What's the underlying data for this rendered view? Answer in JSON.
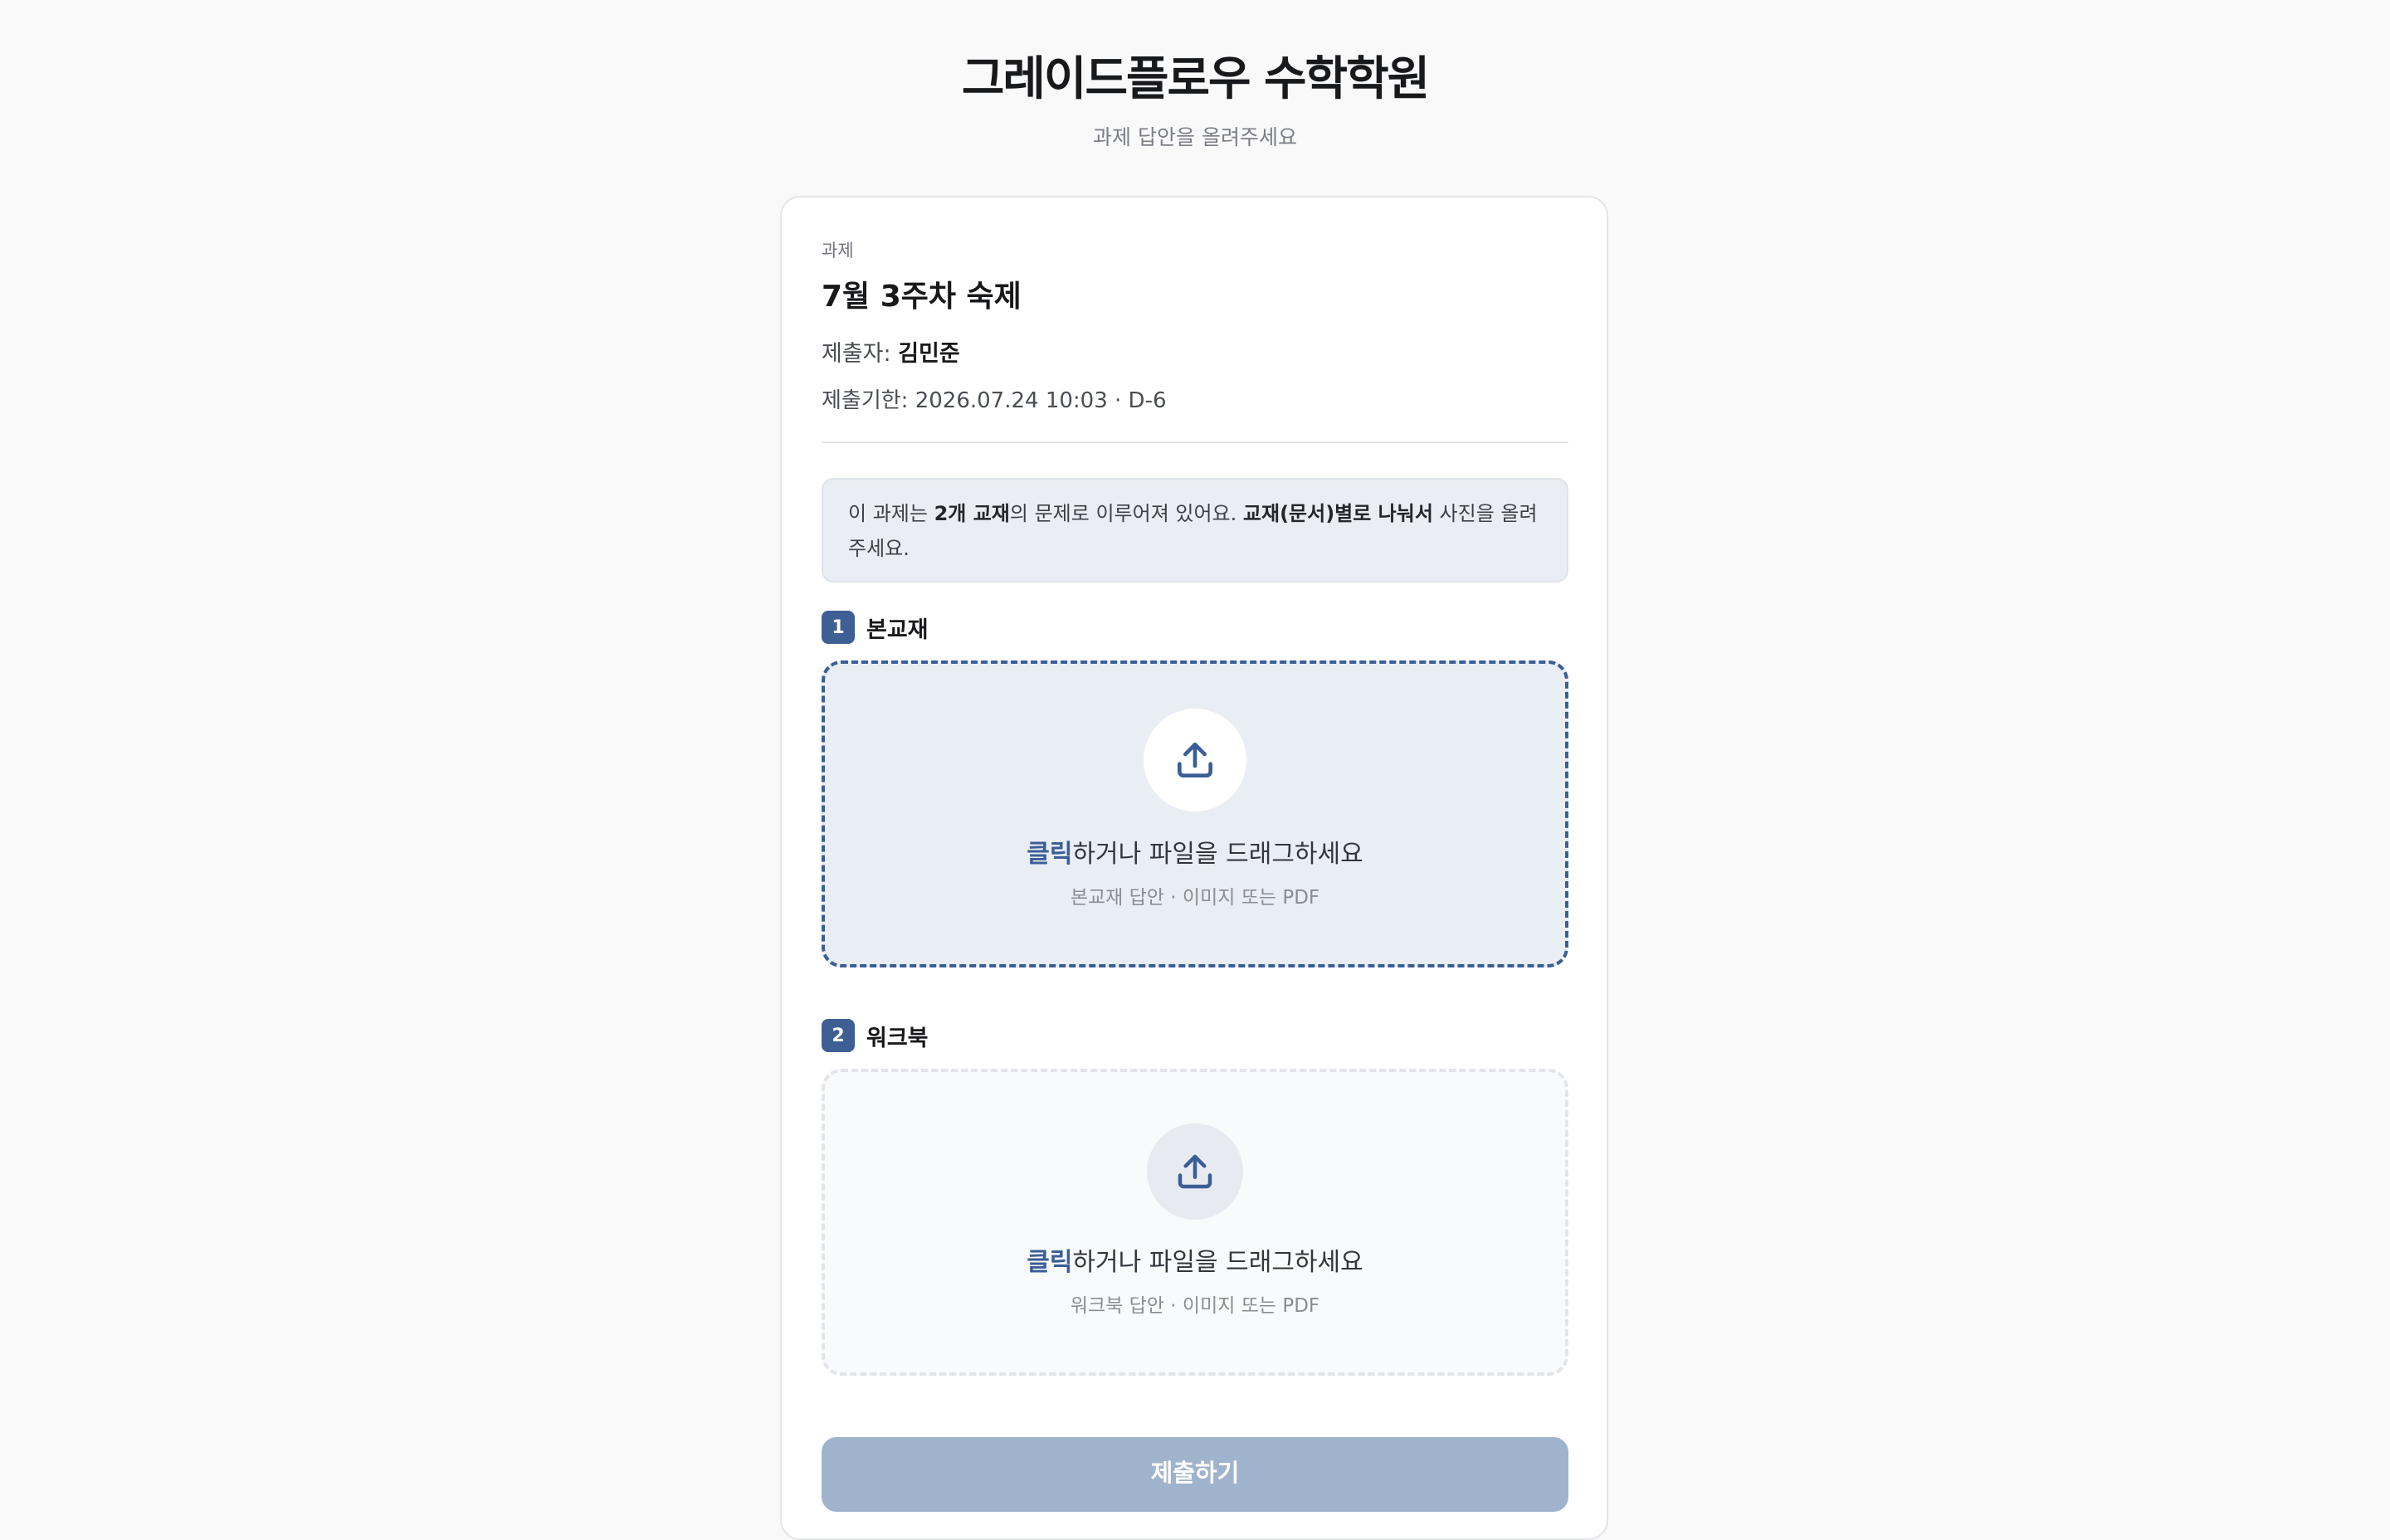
{
  "header": {
    "title": "그레이드플로우 수학학원",
    "subtitle": "과제 답안을 올려주세요"
  },
  "assignment": {
    "label": "과제",
    "title": "7월 3주차 숙제",
    "submitter_label": "제출자: ",
    "submitter_name": "김민준",
    "deadline": "제출기한: 2026.07.24 10:03 · D-6"
  },
  "notice": {
    "part1": "이 과제는 ",
    "bold1": "2개 교재",
    "part2": "의 문제로 이루어져 있어요. ",
    "bold2": "교재(문서)별로 나눠서",
    "part3": " 사진을 올려주세요."
  },
  "sections": [
    {
      "number": "1",
      "title": "본교재",
      "click_text": "클릭",
      "drop_text": "하거나 파일을 드래그하세요",
      "hint": "본교재 답안 · 이미지 또는 PDF"
    },
    {
      "number": "2",
      "title": "워크북",
      "click_text": "클릭",
      "drop_text": "하거나 파일을 드래그하세요",
      "hint": "워크북 답안 · 이미지 또는 PDF"
    }
  ],
  "submit": {
    "label": "제출하기"
  },
  "colors": {
    "accent": "#3b5e96",
    "background": "#f9f9fa",
    "submit_disabled": "#9fb3cd"
  },
  "icons": {
    "upload": "upload-icon"
  }
}
